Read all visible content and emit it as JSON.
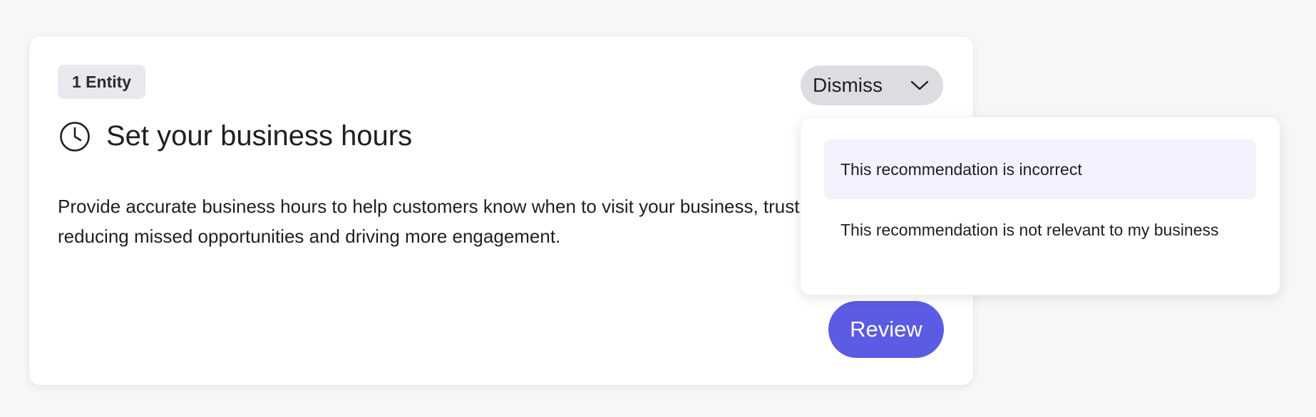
{
  "card": {
    "entity_badge": "1 Entity",
    "title": "Set your business hours",
    "title_icon": "clock-icon",
    "description": "Provide accurate business hours to help customers know when to visit your business, trust, reducing missed opportunities and driving more engagement.",
    "review_label": "Review",
    "dismiss": {
      "label": "Dismiss",
      "icon": "chevron-down-icon",
      "expanded": true,
      "options": [
        {
          "label": "This recommendation is incorrect",
          "highlighted": true
        },
        {
          "label": "This recommendation is not relevant to my business",
          "highlighted": false
        }
      ]
    }
  },
  "colors": {
    "primary": "#5b5be3",
    "badge_bg": "#e8e9ee",
    "dismiss_bg": "#dcdde1",
    "menu_highlight": "#f3f1fd",
    "text": "#1e1e24"
  }
}
